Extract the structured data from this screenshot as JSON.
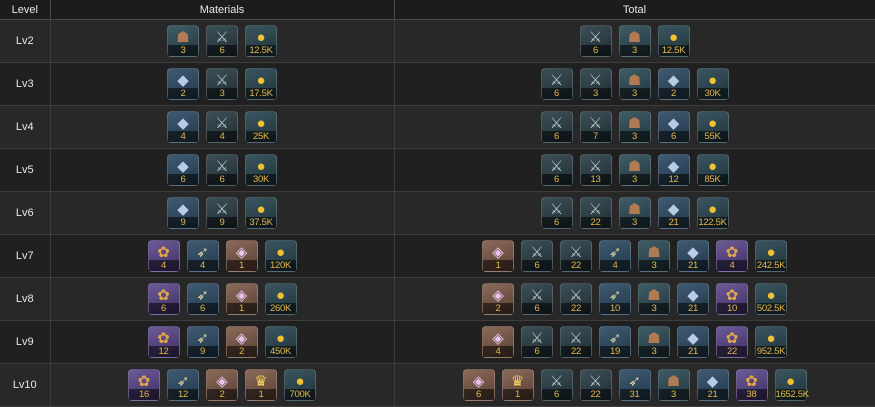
{
  "headers": {
    "level": "Level",
    "materials": "Materials",
    "total": "Total"
  },
  "item_types": {
    "pelt": {
      "icon_name": "pelt-icon",
      "glyph": "☗"
    },
    "blade": {
      "icon_name": "blade-icon",
      "glyph": "⚔"
    },
    "coin": {
      "icon_name": "coin-icon",
      "glyph": "●"
    },
    "ore": {
      "icon_name": "ore-icon",
      "glyph": "◆"
    },
    "mane": {
      "icon_name": "mane-icon",
      "glyph": "✿"
    },
    "fang": {
      "icon_name": "fang-icon",
      "glyph": "➶"
    },
    "gem": {
      "icon_name": "gem-icon",
      "glyph": "◈"
    },
    "crown": {
      "icon_name": "crown-icon",
      "glyph": "♛"
    }
  },
  "colors": {
    "quantity_text": "#e3b84a",
    "row_dark": "#202020",
    "row_light": "#282828"
  },
  "rows": [
    {
      "level": "Lv2",
      "materials": [
        {
          "type": "pelt",
          "qty": "3"
        },
        {
          "type": "blade",
          "qty": "6"
        },
        {
          "type": "coin",
          "qty": "12.5K"
        }
      ],
      "total": [
        {
          "type": "blade",
          "qty": "6"
        },
        {
          "type": "pelt",
          "qty": "3"
        },
        {
          "type": "coin",
          "qty": "12.5K"
        }
      ]
    },
    {
      "level": "Lv3",
      "materials": [
        {
          "type": "ore",
          "qty": "2"
        },
        {
          "type": "blade",
          "qty": "3"
        },
        {
          "type": "coin",
          "qty": "17.5K"
        }
      ],
      "total": [
        {
          "type": "blade",
          "qty": "6"
        },
        {
          "type": "blade",
          "qty": "3"
        },
        {
          "type": "pelt",
          "qty": "3"
        },
        {
          "type": "ore",
          "qty": "2"
        },
        {
          "type": "coin",
          "qty": "30K"
        }
      ]
    },
    {
      "level": "Lv4",
      "materials": [
        {
          "type": "ore",
          "qty": "4"
        },
        {
          "type": "blade",
          "qty": "4"
        },
        {
          "type": "coin",
          "qty": "25K"
        }
      ],
      "total": [
        {
          "type": "blade",
          "qty": "6"
        },
        {
          "type": "blade",
          "qty": "7"
        },
        {
          "type": "pelt",
          "qty": "3"
        },
        {
          "type": "ore",
          "qty": "6"
        },
        {
          "type": "coin",
          "qty": "55K"
        }
      ]
    },
    {
      "level": "Lv5",
      "materials": [
        {
          "type": "ore",
          "qty": "6"
        },
        {
          "type": "blade",
          "qty": "6"
        },
        {
          "type": "coin",
          "qty": "30K"
        }
      ],
      "total": [
        {
          "type": "blade",
          "qty": "6"
        },
        {
          "type": "blade",
          "qty": "13"
        },
        {
          "type": "pelt",
          "qty": "3"
        },
        {
          "type": "ore",
          "qty": "12"
        },
        {
          "type": "coin",
          "qty": "85K"
        }
      ]
    },
    {
      "level": "Lv6",
      "materials": [
        {
          "type": "ore",
          "qty": "9"
        },
        {
          "type": "blade",
          "qty": "9"
        },
        {
          "type": "coin",
          "qty": "37.5K"
        }
      ],
      "total": [
        {
          "type": "blade",
          "qty": "6"
        },
        {
          "type": "blade",
          "qty": "22"
        },
        {
          "type": "pelt",
          "qty": "3"
        },
        {
          "type": "ore",
          "qty": "21"
        },
        {
          "type": "coin",
          "qty": "122.5K"
        }
      ]
    },
    {
      "level": "Lv7",
      "materials": [
        {
          "type": "mane",
          "qty": "4"
        },
        {
          "type": "fang",
          "qty": "4"
        },
        {
          "type": "gem",
          "qty": "1"
        },
        {
          "type": "coin",
          "qty": "120K"
        }
      ],
      "total": [
        {
          "type": "gem",
          "qty": "1"
        },
        {
          "type": "blade",
          "qty": "6"
        },
        {
          "type": "blade",
          "qty": "22"
        },
        {
          "type": "fang",
          "qty": "4"
        },
        {
          "type": "pelt",
          "qty": "3"
        },
        {
          "type": "ore",
          "qty": "21"
        },
        {
          "type": "mane",
          "qty": "4"
        },
        {
          "type": "coin",
          "qty": "242.5K"
        }
      ]
    },
    {
      "level": "Lv8",
      "materials": [
        {
          "type": "mane",
          "qty": "6"
        },
        {
          "type": "fang",
          "qty": "6"
        },
        {
          "type": "gem",
          "qty": "1"
        },
        {
          "type": "coin",
          "qty": "260K"
        }
      ],
      "total": [
        {
          "type": "gem",
          "qty": "2"
        },
        {
          "type": "blade",
          "qty": "6"
        },
        {
          "type": "blade",
          "qty": "22"
        },
        {
          "type": "fang",
          "qty": "10"
        },
        {
          "type": "pelt",
          "qty": "3"
        },
        {
          "type": "ore",
          "qty": "21"
        },
        {
          "type": "mane",
          "qty": "10"
        },
        {
          "type": "coin",
          "qty": "502.5K"
        }
      ]
    },
    {
      "level": "Lv9",
      "materials": [
        {
          "type": "mane",
          "qty": "12"
        },
        {
          "type": "fang",
          "qty": "9"
        },
        {
          "type": "gem",
          "qty": "2"
        },
        {
          "type": "coin",
          "qty": "450K"
        }
      ],
      "total": [
        {
          "type": "gem",
          "qty": "4"
        },
        {
          "type": "blade",
          "qty": "6"
        },
        {
          "type": "blade",
          "qty": "22"
        },
        {
          "type": "fang",
          "qty": "19"
        },
        {
          "type": "pelt",
          "qty": "3"
        },
        {
          "type": "ore",
          "qty": "21"
        },
        {
          "type": "mane",
          "qty": "22"
        },
        {
          "type": "coin",
          "qty": "952.5K"
        }
      ]
    },
    {
      "level": "Lv10",
      "materials": [
        {
          "type": "mane",
          "qty": "16"
        },
        {
          "type": "fang",
          "qty": "12"
        },
        {
          "type": "gem",
          "qty": "2"
        },
        {
          "type": "crown",
          "qty": "1"
        },
        {
          "type": "coin",
          "qty": "700K"
        }
      ],
      "total": [
        {
          "type": "gem",
          "qty": "6"
        },
        {
          "type": "crown",
          "qty": "1"
        },
        {
          "type": "blade",
          "qty": "6"
        },
        {
          "type": "blade",
          "qty": "22"
        },
        {
          "type": "fang",
          "qty": "31"
        },
        {
          "type": "pelt",
          "qty": "3"
        },
        {
          "type": "ore",
          "qty": "21"
        },
        {
          "type": "mane",
          "qty": "38"
        },
        {
          "type": "coin",
          "qty": "1652.5K"
        }
      ]
    }
  ]
}
